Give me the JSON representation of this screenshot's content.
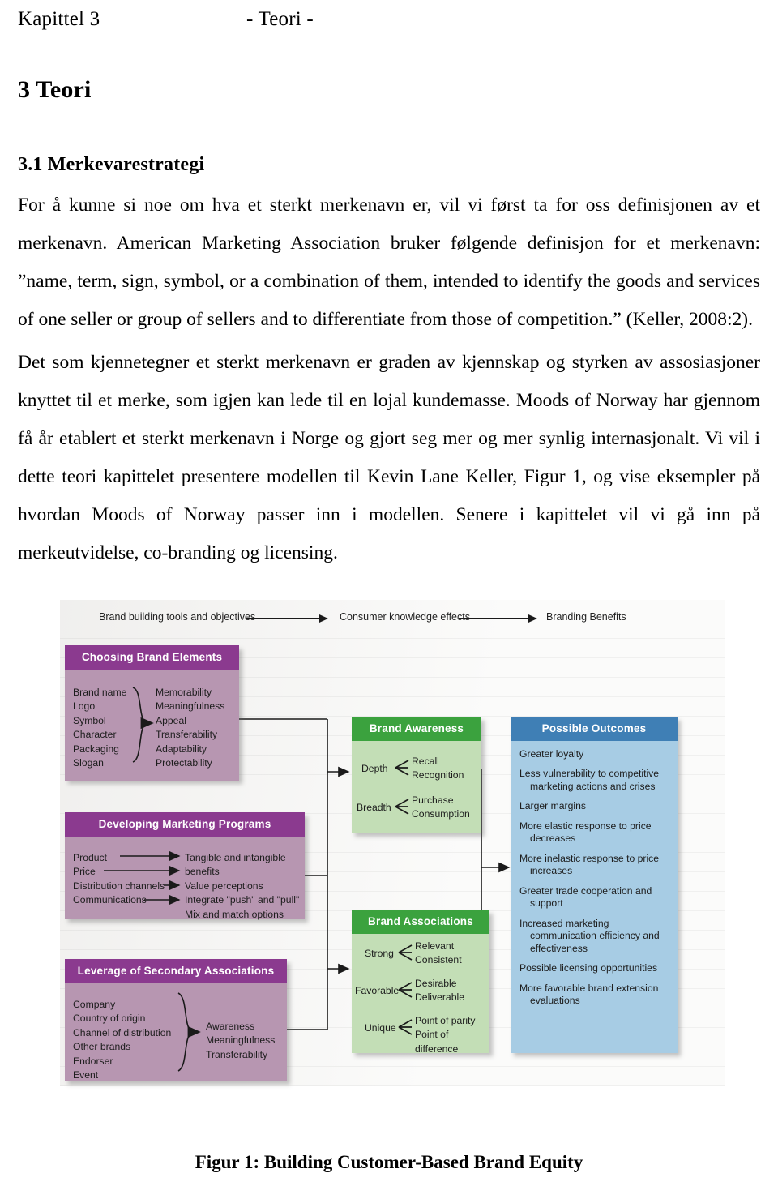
{
  "running_header": {
    "left": "Kapittel 3",
    "center": "- Teori -"
  },
  "headings": {
    "h1": "3 Teori",
    "h2": "3.1 Merkevarestrategi"
  },
  "paragraphs": {
    "p1": "For å kunne si noe om hva et sterkt merkenavn er, vil vi først ta for oss definisjonen av et merkenavn. American Marketing Association bruker følgende definisjon for et merkenavn: ”name, term, sign, symbol, or a combination of them, intended to identify the goods and services of one seller or group of sellers and  to differentiate from those of competition.” (Keller, 2008:2).",
    "p2": "Det som kjennetegner et sterkt merkenavn er graden av kjennskap og styrken av assosiasjoner knyttet til et merke, som igjen kan lede til en lojal kundemasse. Moods of Norway har gjennom få år etablert et sterkt merkenavn i Norge og gjort seg mer og mer synlig internasjonalt. Vi vil i dette teori kapittelet presentere modellen til Kevin Lane Keller, Figur 1, og vise eksempler på hvordan Moods of Norway passer inn i modellen. Senere i kapittelet vil vi gå inn på merkeutvidelse, co-branding og licensing."
  },
  "figure": {
    "caption": "Figur 1: Building Customer-Based Brand Equity",
    "flow_labels": [
      "Brand building tools and objectives",
      "Consumer knowledge effects",
      "Branding Benefits"
    ],
    "colors": {
      "purple_header": "#8b3a8f",
      "purple_body": "#b796b1",
      "green_header": "#3ba23e",
      "green_body": "#c3deb6",
      "blue_header": "#3f7fb5",
      "blue_body": "#a7cce4"
    },
    "boxes": {
      "choosing_brand_elements": {
        "title": "Choosing Brand Elements",
        "left_items": "Brand name\nLogo\nSymbol\nCharacter\nPackaging\nSlogan",
        "right_items": "Memorability\nMeaningfulness\nAppeal\nTransferability\nAdaptability\nProtectability"
      },
      "developing_marketing_programs": {
        "title": "Developing Marketing Programs",
        "left_items": "Product\nPrice\nDistribution channels\nCommunications",
        "right_items": "Tangible and intangible benefits\nValue perceptions\nIntegrate \"push\" and \"pull\"\nMix and match options"
      },
      "leverage_of_secondary_associations": {
        "title": "Leverage of Secondary Associations",
        "left_items": "Company\nCountry of origin\nChannel of distribution\nOther brands\nEndorser\nEvent",
        "right_items": "Awareness\nMeaningfulness\nTransferability"
      },
      "brand_awareness": {
        "title": "Brand Awareness",
        "rows": [
          {
            "label": "Depth",
            "values": "Recall\nRecognition"
          },
          {
            "label": "Breadth",
            "values": "Purchase\nConsumption"
          }
        ]
      },
      "brand_associations": {
        "title": "Brand Associations",
        "rows": [
          {
            "label": "Strong",
            "values": "Relevant\nConsistent"
          },
          {
            "label": "Favorable",
            "values": "Desirable\nDeliverable"
          },
          {
            "label": "Unique",
            "values": "Point of parity\nPoint of difference"
          }
        ]
      },
      "possible_outcomes": {
        "title": "Possible Outcomes",
        "items": [
          "Greater loyalty",
          "Less vulnerability to competitive marketing actions and crises",
          "Larger margins",
          "More elastic response to price decreases",
          "More inelastic response to price increases",
          "Greater trade cooperation and support",
          "Increased marketing communication efficiency and effectiveness",
          "Possible licensing opportunities",
          "More favorable brand extension evaluations"
        ]
      }
    }
  }
}
